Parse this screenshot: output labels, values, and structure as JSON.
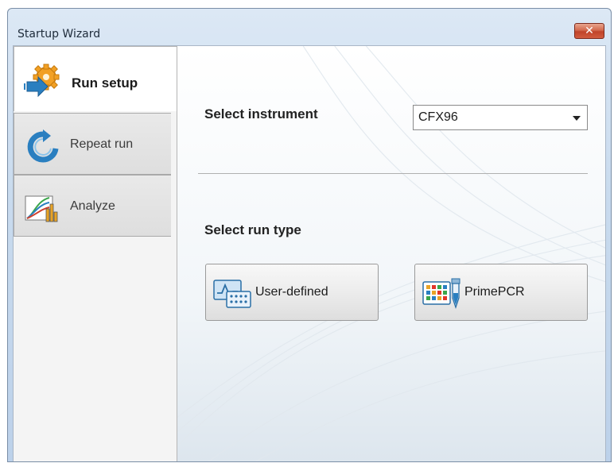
{
  "window": {
    "title": "Startup Wizard",
    "close_symbol": "✕"
  },
  "tabs": [
    {
      "label": "Run setup",
      "icon": "run-setup-gear-icon",
      "active": true
    },
    {
      "label": "Repeat run",
      "icon": "repeat-arrow-icon",
      "active": false
    },
    {
      "label": "Analyze",
      "icon": "analyze-chart-icon",
      "active": false
    }
  ],
  "panel": {
    "instrument_label": "Select instrument",
    "instrument_value": "CFX96",
    "run_type_label": "Select run type",
    "buttons": [
      {
        "label": "User-defined",
        "icon": "user-defined-plate-icon"
      },
      {
        "label": "PrimePCR",
        "icon": "primepcr-plate-icon"
      }
    ]
  },
  "colors": {
    "title_bar": "#c9dbee",
    "close_button": "#c94a30",
    "panel_bg": "#f7fafc",
    "icon_blue": "#2a7fc0",
    "icon_orange": "#f2a024"
  }
}
